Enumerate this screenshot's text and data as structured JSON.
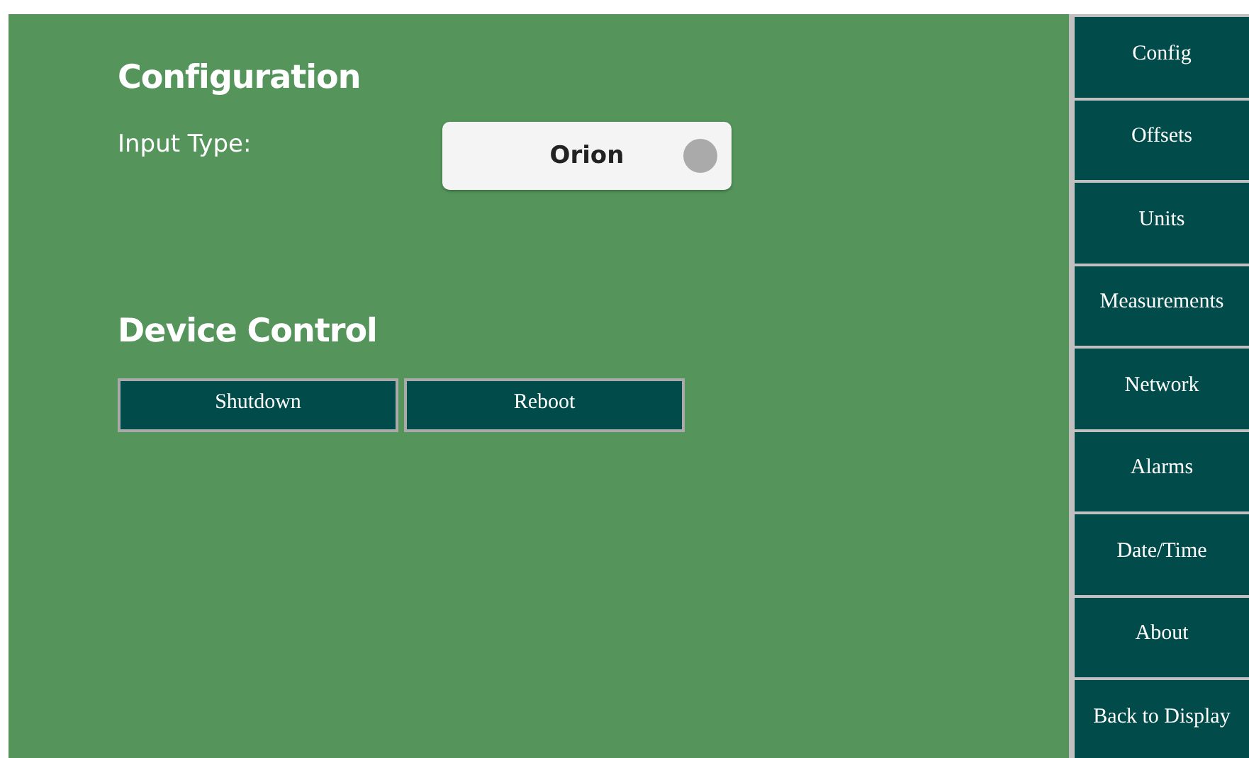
{
  "configuration": {
    "title": "Configuration",
    "input_type": {
      "label": "Input Type:",
      "value": "Orion"
    }
  },
  "device_control": {
    "title": "Device Control",
    "buttons": [
      "Shutdown",
      "Reboot"
    ]
  },
  "sidebar": {
    "items": [
      "Config",
      "Offsets",
      "Units",
      "Measurements",
      "Network",
      "Alarms",
      "Date/Time",
      "About",
      "Back to Display"
    ]
  }
}
